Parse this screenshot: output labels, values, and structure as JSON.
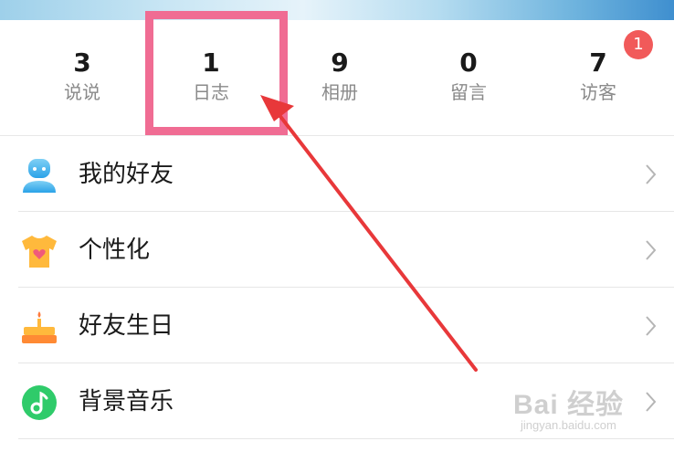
{
  "stats": [
    {
      "value": "3",
      "label": "说说"
    },
    {
      "value": "1",
      "label": "日志"
    },
    {
      "value": "9",
      "label": "相册"
    },
    {
      "value": "0",
      "label": "留言"
    },
    {
      "value": "7",
      "label": "访客"
    }
  ],
  "visitor_badge": "1",
  "menu": [
    {
      "label": "我的好友",
      "icon": "friends-icon"
    },
    {
      "label": "个性化",
      "icon": "personalize-icon"
    },
    {
      "label": "好友生日",
      "icon": "birthday-cake-icon"
    },
    {
      "label": "背景音乐",
      "icon": "music-note-icon"
    }
  ],
  "colors": {
    "highlight_box": "#f06c93",
    "arrow": "#e8383a",
    "badge": "#f15a5a"
  },
  "watermark": {
    "main": "Bai 经验",
    "sub": "jingyan.baidu.com"
  }
}
